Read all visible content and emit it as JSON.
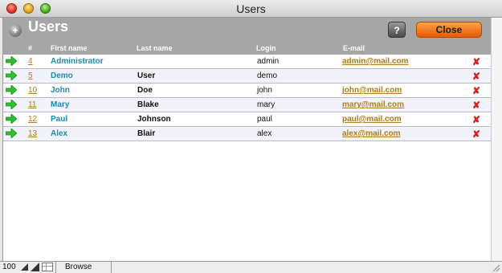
{
  "window": {
    "title": "Users"
  },
  "header": {
    "title": "Users",
    "add_icon": "+",
    "help_label": "?",
    "close_label": "Close",
    "columns": {
      "num": "#",
      "first_name": "First name",
      "last_name": "Last name",
      "login": "Login",
      "email": "E-mail"
    }
  },
  "users": [
    {
      "id": "4",
      "first_name": "Administrator",
      "last_name": "",
      "login": "admin",
      "email": "admin@mail.com"
    },
    {
      "id": "5",
      "first_name": "Demo",
      "last_name": "User",
      "login": "demo",
      "email": ""
    },
    {
      "id": "10",
      "first_name": "John",
      "last_name": "Doe",
      "login": "john",
      "email": "john@mail.com"
    },
    {
      "id": "11",
      "first_name": "Mary",
      "last_name": "Blake",
      "login": "mary",
      "email": "mary@mail.com"
    },
    {
      "id": "12",
      "first_name": "Paul",
      "last_name": "Johnson",
      "login": "paul",
      "email": "paul@mail.com"
    },
    {
      "id": "13",
      "first_name": "Alex",
      "last_name": "Blair",
      "login": "alex",
      "email": "alex@mail.com"
    }
  ],
  "row_icons": {
    "open": "arrow-right-icon",
    "delete": "delete-x-icon",
    "delete_glyph": "✘"
  },
  "status": {
    "zoom": "100",
    "mode": "Browse"
  },
  "colors": {
    "accent_orange": "#e55b00",
    "link_gold": "#b07a17",
    "name_blue": "#1a8ab0",
    "delete_red": "#d42020",
    "arrow_green": "#2fbf2f"
  }
}
